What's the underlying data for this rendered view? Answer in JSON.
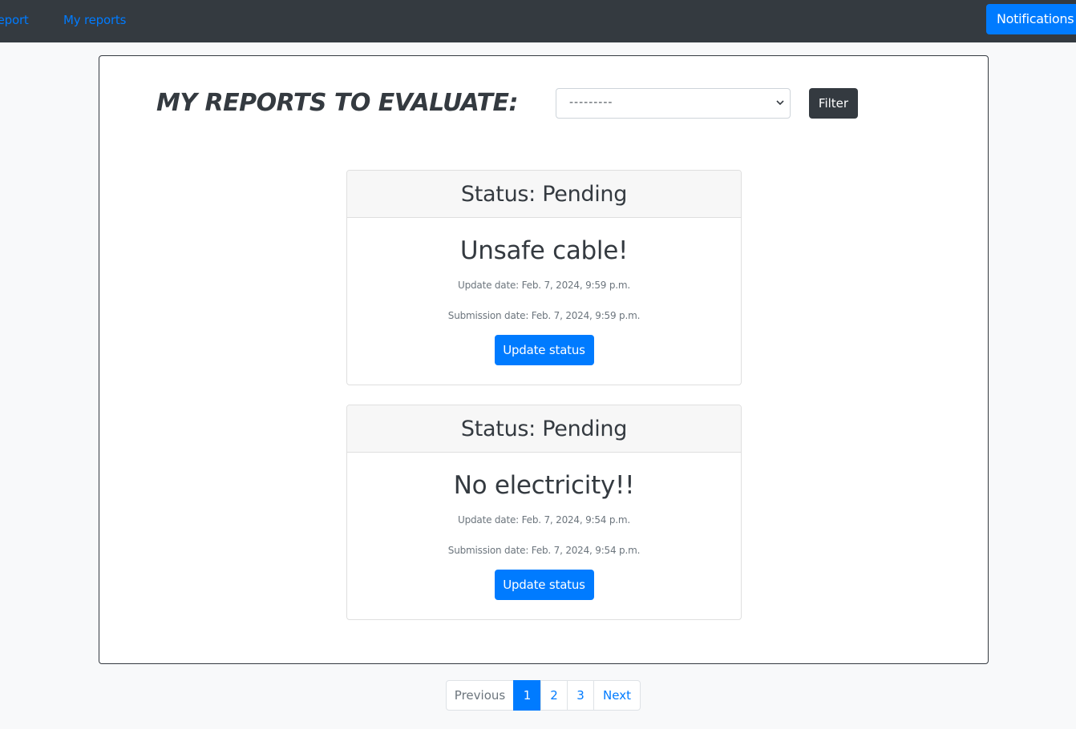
{
  "navbar": {
    "link_report": "report",
    "link_my_reports": "My reports",
    "notifications_label": "Notifications"
  },
  "main": {
    "title": "MY REPORTS TO EVALUATE:",
    "filter_select": {
      "selected": "---------"
    },
    "filter_button": "Filter"
  },
  "reports": [
    {
      "status": "Status: Pending",
      "title": "Unsafe cable!",
      "update_date": "Update date: Feb. 7, 2024, 9:59 p.m.",
      "submission_date": "Submission date: Feb. 7, 2024, 9:59 p.m.",
      "button": "Update status"
    },
    {
      "status": "Status: Pending",
      "title": "No electricity!!",
      "update_date": "Update date: Feb. 7, 2024, 9:54 p.m.",
      "submission_date": "Submission date: Feb. 7, 2024, 9:54 p.m.",
      "button": "Update status"
    }
  ],
  "pagination": {
    "previous": "Previous",
    "pages": [
      "1",
      "2",
      "3"
    ],
    "active_page": "1",
    "next": "Next"
  },
  "colors": {
    "navbar_bg": "#343a40",
    "primary": "#007bff",
    "page_bg": "#f8f9fa",
    "muted": "#6c757d"
  }
}
